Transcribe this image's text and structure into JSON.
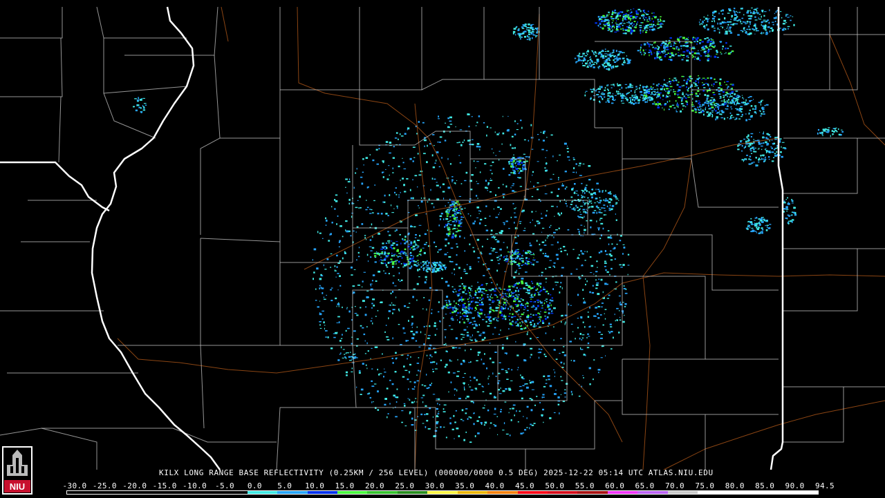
{
  "logo": {
    "text": "NIU",
    "name": "niu-logo"
  },
  "caption": "KILX LONG RANGE BASE REFLECTIVITY (0.25KM / 256 LEVEL) (000000/0000 0.5 DEG) 2025-12-22 05:14 UTC  ATLAS.NIU.EDU",
  "legend": {
    "ticks": [
      "-30.0",
      "-25.0",
      "-20.0",
      "-15.0",
      "-10.0",
      "-5.0",
      "0.0",
      "5.0",
      "10.0",
      "15.0",
      "20.0",
      "25.0",
      "30.0",
      "35.0",
      "40.0",
      "45.0",
      "50.0",
      "55.0",
      "60.0",
      "65.0",
      "70.0",
      "75.0",
      "80.0",
      "85.0",
      "90.0",
      "94.5"
    ],
    "colors": [
      "#000000",
      "#000000",
      "#000000",
      "#000000",
      "#000000",
      "#000000",
      "#40e8e3",
      "#26a4fa",
      "#0030ed",
      "#49fb3e",
      "#36c22e",
      "#278c1e",
      "#fef543",
      "#ebb608",
      "#f6820f",
      "#fd0717",
      "#d60c1a",
      "#a81212",
      "#ee34fa",
      "#ba62f3",
      "#c9c9c9",
      "#ffffff",
      "#ffffff",
      "#ffffff",
      "#ffffff"
    ]
  },
  "colors": {
    "background": "#000000",
    "county_lines": "#c8c8c8",
    "state_lines": "#ffffff",
    "roads": "#8b4513"
  }
}
